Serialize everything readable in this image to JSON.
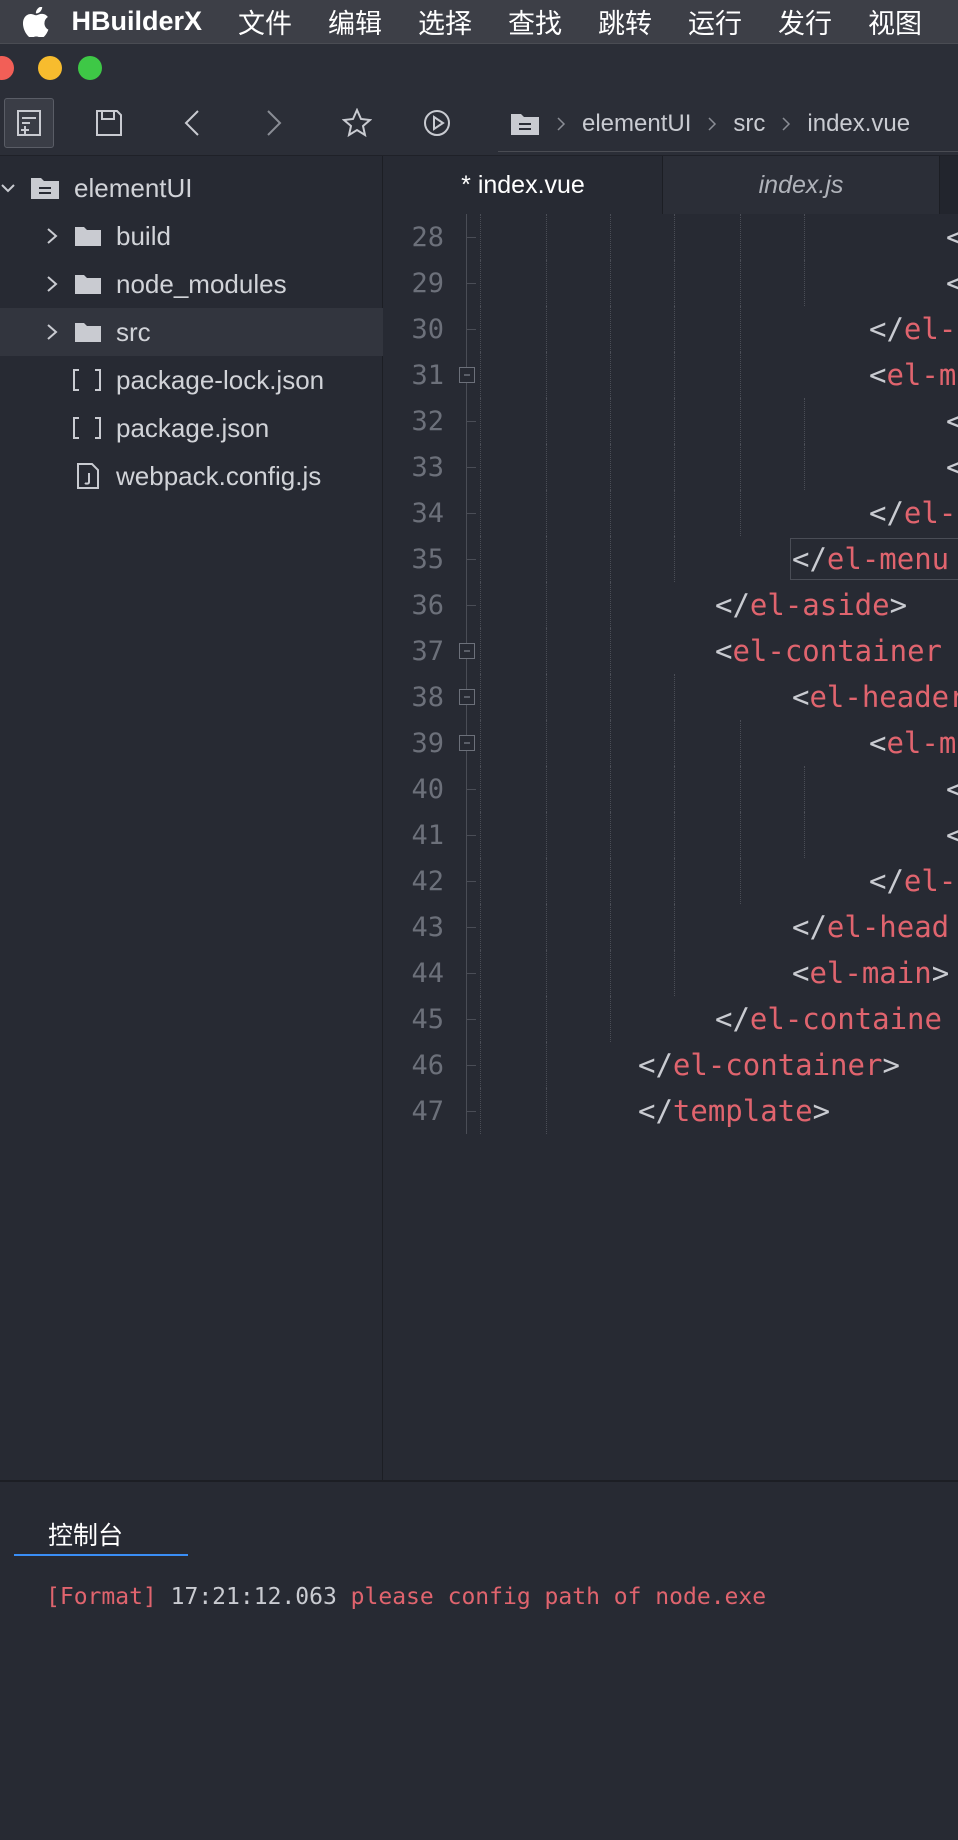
{
  "menubar": {
    "app_name": "HBuilderX",
    "items": [
      "文件",
      "编辑",
      "选择",
      "查找",
      "跳转",
      "运行",
      "发行",
      "视图"
    ]
  },
  "breadcrumb": [
    "elementUI",
    "src",
    "index.vue"
  ],
  "tabs": [
    {
      "label": "* index.vue",
      "active": true
    },
    {
      "label": "index.js",
      "active": false
    }
  ],
  "project_tree": [
    {
      "label": "elementUI",
      "type": "project",
      "expanded": true
    },
    {
      "label": "build",
      "type": "folder"
    },
    {
      "label": "node_modules",
      "type": "folder"
    },
    {
      "label": "src",
      "type": "folder",
      "selected": true
    },
    {
      "label": "package-lock.json",
      "type": "json"
    },
    {
      "label": "package.json",
      "type": "json"
    },
    {
      "label": "webpack.config.js",
      "type": "js"
    }
  ],
  "editor": {
    "lines": [
      {
        "n": "28",
        "indent": 7,
        "open": "<",
        "tag": "",
        "close": ""
      },
      {
        "n": "29",
        "indent": 7,
        "open": "<",
        "tag": "",
        "close": ""
      },
      {
        "n": "30",
        "indent": 6,
        "open": "</",
        "tag": "el-",
        "close": ""
      },
      {
        "n": "31",
        "indent": 6,
        "open": "<",
        "tag": "el-m",
        "close": "",
        "fold": true
      },
      {
        "n": "32",
        "indent": 7,
        "open": "<",
        "tag": "",
        "close": ""
      },
      {
        "n": "33",
        "indent": 7,
        "open": "<",
        "tag": "",
        "close": ""
      },
      {
        "n": "34",
        "indent": 6,
        "open": "</",
        "tag": "el-",
        "close": ""
      },
      {
        "n": "35",
        "indent": 5,
        "open": "</",
        "tag": "el-menu",
        "close": ""
      },
      {
        "n": "36",
        "indent": 4,
        "open": "</",
        "tag": "el-aside",
        "close": ">"
      },
      {
        "n": "37",
        "indent": 4,
        "open": "<",
        "tag": "el-container",
        "close": "",
        "fold": true
      },
      {
        "n": "38",
        "indent": 5,
        "open": "<",
        "tag": "el-header",
        "close": "",
        "fold": true
      },
      {
        "n": "39",
        "indent": 6,
        "open": "<",
        "tag": "el-m",
        "close": "",
        "fold": true
      },
      {
        "n": "40",
        "indent": 7,
        "open": "<",
        "tag": "",
        "close": ""
      },
      {
        "n": "41",
        "indent": 7,
        "open": "<",
        "tag": "",
        "close": ""
      },
      {
        "n": "42",
        "indent": 6,
        "open": "</",
        "tag": "el-",
        "close": ""
      },
      {
        "n": "43",
        "indent": 5,
        "open": "</",
        "tag": "el-head",
        "close": ""
      },
      {
        "n": "44",
        "indent": 5,
        "open": "<",
        "tag": "el-main",
        "close": ">"
      },
      {
        "n": "45",
        "indent": 4,
        "open": "</",
        "tag": "el-containe",
        "close": ""
      },
      {
        "n": "46",
        "indent": 3,
        "open": "</",
        "tag": "el-container",
        "close": ">"
      },
      {
        "n": "47",
        "indent": 3,
        "open": "</",
        "tag": "template",
        "close": ">"
      }
    ]
  },
  "console": {
    "tab_label": "控制台",
    "prefix": "[Format]",
    "time": "17:21:12.063",
    "message": "please config path of node.exe"
  },
  "colors": {
    "tag": "#e0646e",
    "accent": "#3a8ef6",
    "background": "#272a33"
  }
}
